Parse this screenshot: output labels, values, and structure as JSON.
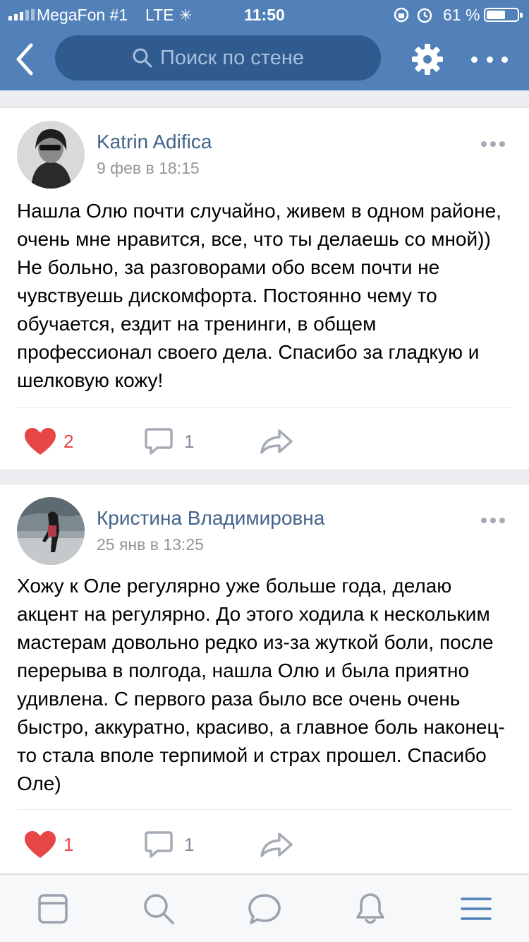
{
  "status_bar": {
    "carrier": "MegaFon #1",
    "network": "LTE",
    "time": "11:50",
    "battery_percent": "61 %",
    "battery_level": 0.61
  },
  "nav": {
    "search_placeholder": "Поиск по стене",
    "icons": [
      "back-chevron-icon",
      "search-icon",
      "gear-icon",
      "more-icon"
    ]
  },
  "posts": [
    {
      "author": "Katrin Adifica",
      "date": "9 фев в 18:15",
      "text": "Нашла Олю почти случайно, живем в одном районе, очень мне нравится, все, что ты делаешь со мной)) Не больно, за разговорами обо всем почти не чувствуешь дискомфорта. Постоянно чему то обучается, ездит на тренинги, в общем профессионал своего дела. Спасибо за гладкую и шелковую кожу!",
      "likes": "2",
      "comments": "1"
    },
    {
      "author": "Кристина Владимировна",
      "date": "25 янв в 13:25",
      "text": "Хожу к Оле регулярно уже больше года, делаю акцент на регулярно. До этого ходила к нескольким мастерам довольно редко из-за жуткой боли, после перерыва в полгода, нашла Олю и была приятно удивлена. С первого раза было все очень очень быстро, аккуратно, красиво, а главное боль наконец-то стала вполе терпимой и страх прошел. Спасибо Оле)",
      "likes": "1",
      "comments": "1"
    }
  ],
  "tabbar": {
    "icons": [
      "news-icon",
      "search-icon",
      "messages-icon",
      "notifications-icon",
      "menu-icon"
    ],
    "active": "menu-icon"
  },
  "colors": {
    "header": "#5181b8",
    "search_field": "#2f5b8f",
    "author": "#42648b",
    "like": "#e64646",
    "muted": "#828a99"
  }
}
